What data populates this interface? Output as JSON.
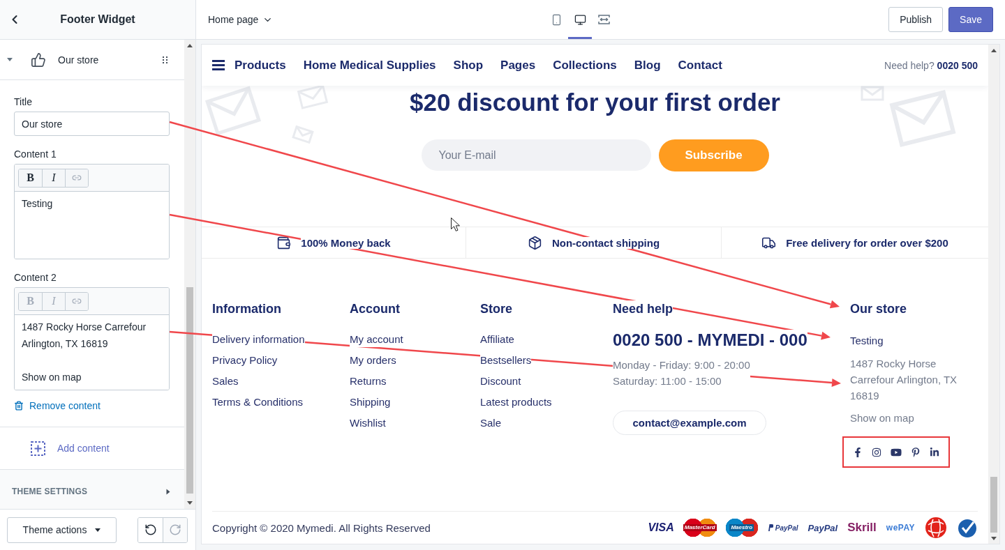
{
  "sidebar": {
    "title": "Footer Widget",
    "block": {
      "label": "Our store",
      "expanded": true
    },
    "fields": [
      {
        "kind": "text",
        "label": "Title",
        "value": "Our store"
      },
      {
        "kind": "richtext",
        "label": "Content 1",
        "tools": [
          {
            "kind": "bold",
            "label": "B",
            "disabled": false
          },
          {
            "kind": "italic",
            "label": "I",
            "disabled": false
          },
          {
            "kind": "link",
            "disabled": true
          }
        ],
        "paragraphs": [
          [
            "Testing"
          ]
        ]
      },
      {
        "kind": "richtext",
        "label": "Content 2",
        "tools": [
          {
            "kind": "bold",
            "label": "B",
            "disabled": true
          },
          {
            "kind": "italic",
            "label": "I",
            "disabled": true
          },
          {
            "kind": "link",
            "disabled": true
          }
        ],
        "paragraphs": [
          [
            "1487 Rocky Horse Carrefour",
            "Arlington, TX 16819"
          ],
          [
            "Show on map"
          ]
        ]
      }
    ],
    "remove": "Remove content",
    "add": "Add content",
    "theme_settings": {
      "label": "THEME SETTINGS",
      "expanded": false
    },
    "theme_actions": "Theme actions",
    "history": [
      {
        "kind": "undo",
        "disabled": false
      },
      {
        "kind": "redo",
        "disabled": true
      }
    ]
  },
  "toolbar": {
    "page": "Home page",
    "devices": [
      {
        "kind": "mobile",
        "selected": false
      },
      {
        "kind": "desktop",
        "selected": true
      },
      {
        "kind": "fullwidth",
        "selected": false
      }
    ],
    "buttons": [
      {
        "kind": "secondary",
        "label": "Publish"
      },
      {
        "kind": "primary",
        "label": "Save"
      }
    ]
  },
  "preview": {
    "nav": {
      "items": [
        "Products",
        "Home Medical Supplies",
        "Shop",
        "Pages",
        "Collections",
        "Blog",
        "Contact"
      ],
      "help": "Need help? **0020 500**"
    },
    "hero": {
      "title": "$20 discount for your first order",
      "email_placeholder": "Your E-mail",
      "button": "Subscribe"
    },
    "features": [
      {
        "kind": "wallet",
        "label": "100% Money back"
      },
      {
        "kind": "box",
        "label": "Non-contact shipping"
      },
      {
        "kind": "truck",
        "label": "Free delivery for order over $200"
      }
    ],
    "footer_columns": [
      {
        "kind": "links",
        "title": "Information",
        "links": [
          "Delivery information",
          "Privacy Policy",
          "Sales",
          "Terms & Conditions"
        ]
      },
      {
        "kind": "links",
        "title": "Account",
        "links": [
          "My account",
          "My orders",
          "Returns",
          "Shipping",
          "Wishlist"
        ]
      },
      {
        "kind": "links",
        "title": "Store",
        "links": [
          "Affiliate",
          "Bestsellers",
          "Discount",
          "Latest products",
          "Sale"
        ]
      },
      {
        "kind": "help",
        "title": "Need help",
        "phone": "0020 500 - MYMEDI - 000",
        "hours": [
          "Monday - Friday: 9:00 - 20:00",
          "Saturday: 11:00 - 15:00"
        ],
        "email": "contact@example.com"
      },
      {
        "kind": "store",
        "title": "Our store",
        "content": "Testing",
        "address": "1487 Rocky Horse Carrefour Arlington, TX 16819",
        "map_link": "Show on map",
        "highlighted": true,
        "social": [
          {
            "kind": "facebook"
          },
          {
            "kind": "instagram"
          },
          {
            "kind": "youtube"
          },
          {
            "kind": "pinterest"
          },
          {
            "kind": "linkedin"
          }
        ]
      }
    ],
    "copyright": "Copyright © 2020 Mymedi. All Rights Reserved",
    "payments": [
      {
        "kind": "visa",
        "label": "VISA"
      },
      {
        "kind": "mastercard",
        "label": "MasterCard"
      },
      {
        "kind": "maestro",
        "label": "Maestro"
      },
      {
        "kind": "paypal_mark",
        "label": "PayPal"
      },
      {
        "kind": "paypal",
        "label": "PayPal"
      },
      {
        "kind": "skrill",
        "label": "Skrill"
      },
      {
        "kind": "wepay",
        "label": "wePAY"
      },
      {
        "kind": "globe"
      },
      {
        "kind": "check"
      }
    ]
  },
  "annotations": [
    {
      "kind": "arrow"
    },
    {
      "kind": "arrow"
    },
    {
      "kind": "arrow"
    },
    {
      "kind": "cursor"
    }
  ]
}
